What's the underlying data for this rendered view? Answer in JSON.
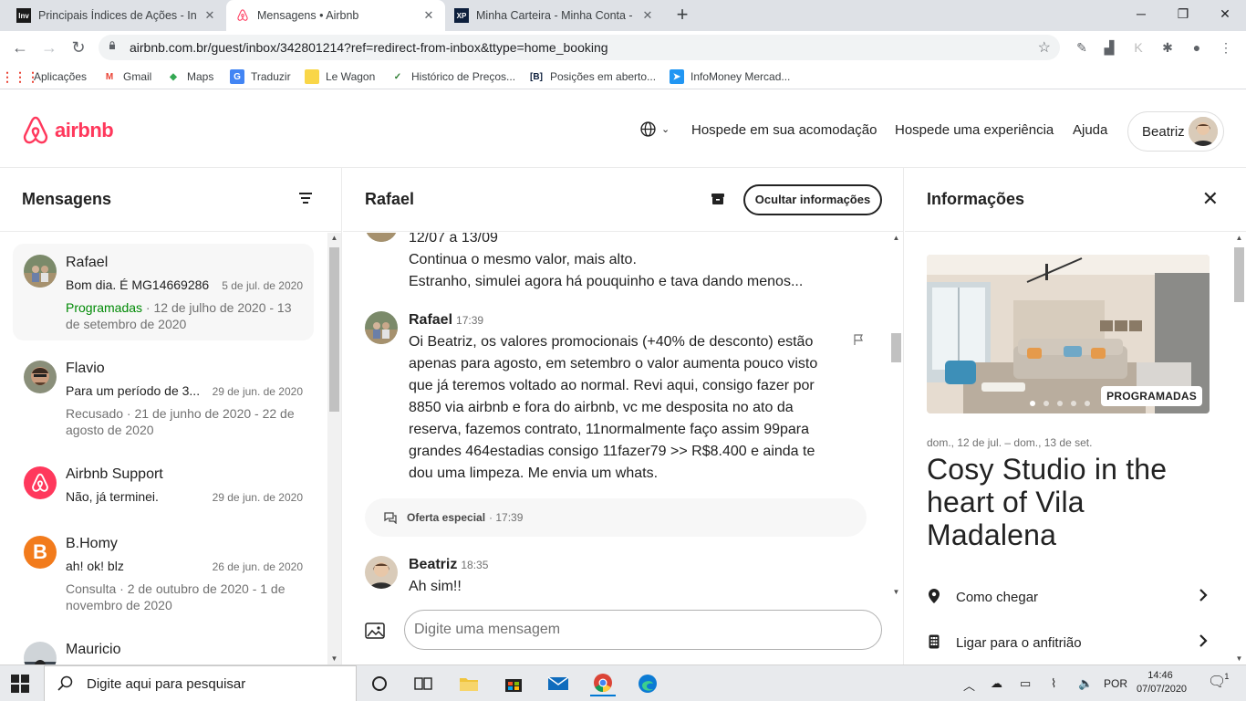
{
  "browser": {
    "tabs": [
      {
        "title": "Principais Índices de Ações - Inve",
        "favicon": "Inv",
        "active": false
      },
      {
        "title": "Mensagens • Airbnb",
        "favicon": "airbnb",
        "active": true
      },
      {
        "title": "Minha Carteira - Minha Conta - X",
        "favicon": "XP",
        "active": false
      }
    ],
    "url": "airbnb.com.br/guest/inbox/342801214?ref=redirect-from-inbox&ttype=home_booking",
    "bookmarks": [
      "Aplicações",
      "Gmail",
      "Maps",
      "Traduzir",
      "Le Wagon",
      "Histórico de Preços...",
      "Posições em aberto...",
      "InfoMoney Mercad..."
    ]
  },
  "header": {
    "logo_text": "airbnb",
    "links": [
      "Hospede em sua acomodação",
      "Hospede uma experiência",
      "Ajuda"
    ],
    "user_name": "Beatriz"
  },
  "inbox": {
    "title": "Mensagens",
    "conversations": [
      {
        "name": "Rafael",
        "preview": "Bom dia. É MG14669286",
        "date": "5 de jul. de 2020",
        "status_label": "Programadas",
        "status_rest": " · 12 de julho de 2020 - 13 de setembro de 2020"
      },
      {
        "name": "Flavio",
        "preview": "Para um período de 3...",
        "date": "29 de jun. de 2020",
        "status_label": "",
        "status_rest": "Recusado · 21 de junho de 2020 - 22 de agosto de 2020"
      },
      {
        "name": "Airbnb Support",
        "preview": "Não, já terminei.",
        "date": "29 de jun. de 2020",
        "status_label": "",
        "status_rest": ""
      },
      {
        "name": "B.Homy",
        "preview": "ah! ok! blz",
        "date": "26 de jun. de 2020",
        "status_label": "",
        "status_rest": "Consulta · 2 de outubro de 2020 - 1 de novembro de 2020"
      },
      {
        "name": "Mauricio",
        "preview": "",
        "date": "",
        "status_label": "",
        "status_rest": ""
      }
    ]
  },
  "thread": {
    "contact": "Rafael",
    "hide_info_label": "Ocultar informações",
    "earlier_lines": [
      "12/07 a 13/09",
      "Continua o mesmo valor, mais alto.",
      "Estranho, simulei agora há pouquinho e tava dando menos..."
    ],
    "message1": {
      "author": "Rafael",
      "time": "17:39",
      "lines": [
        "Oi Beatriz, os valores promocionais (+40% de desconto) estão",
        "apenas para agosto, em setembro o valor aumenta pouco visto",
        "que já teremos voltado ao normal. Revi aqui, consigo fazer por",
        "8850 via airbnb e fora do airbnb, vc me desposita no ato da",
        "reserva, fazemos contrato, 11normalmente faço assim 99para",
        "grandes 464estadias consigo 11fazer79 >> R$8.400 e ainda te",
        "dou uma limpeza. Me envia um whats."
      ]
    },
    "special_offer": {
      "label": "Oferta especial",
      "time": "· 17:39"
    },
    "message2": {
      "author": "Beatriz",
      "time": "18:35",
      "text": "Ah sim!!"
    },
    "composer_placeholder": "Digite uma mensagem"
  },
  "info": {
    "title": "Informações",
    "badge": "PROGRAMADAS",
    "dates": "dom., 12 de jul. – dom., 13 de set.",
    "listing_title": "Cosy Studio in the heart of Vila Madalena",
    "actions": [
      "Como chegar",
      "Ligar para o anfitrião"
    ]
  },
  "taskbar": {
    "search_placeholder": "Digite aqui para pesquisar",
    "language": "POR",
    "time": "14:46",
    "date": "07/07/2020",
    "notifications": "1"
  },
  "colors": {
    "brand": "#ff385c",
    "scheduled_green": "#008a05"
  }
}
